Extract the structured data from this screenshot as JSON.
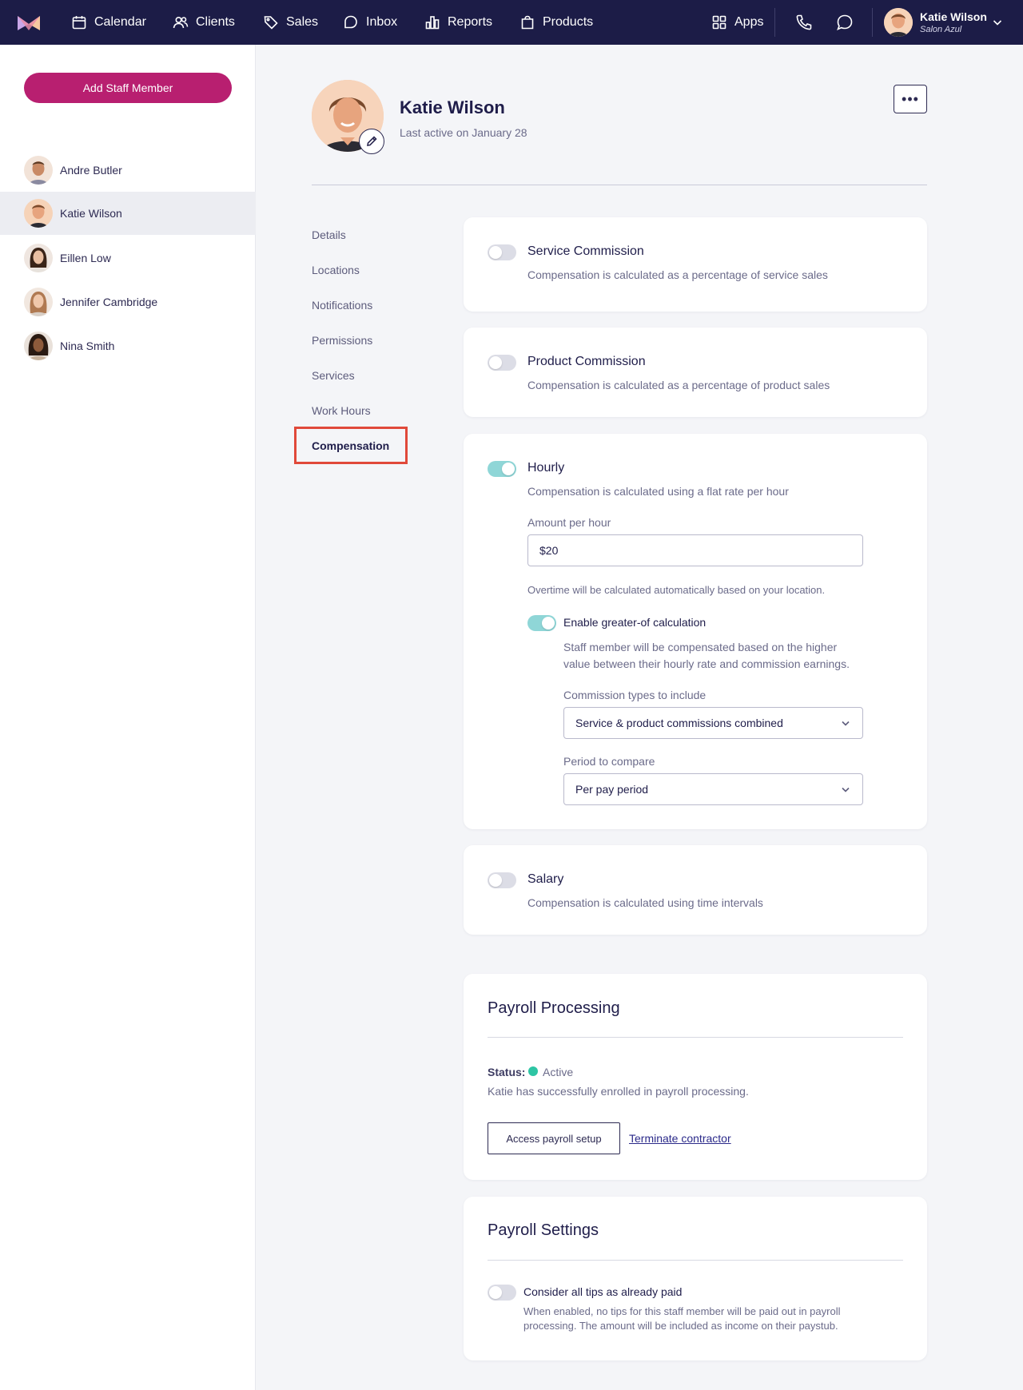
{
  "nav": {
    "items": [
      {
        "label": "Calendar",
        "icon": "calendar-icon"
      },
      {
        "label": "Clients",
        "icon": "clients-icon"
      },
      {
        "label": "Sales",
        "icon": "tag-icon"
      },
      {
        "label": "Inbox",
        "icon": "inbox-icon"
      },
      {
        "label": "Reports",
        "icon": "reports-icon"
      },
      {
        "label": "Products",
        "icon": "bag-icon"
      }
    ],
    "apps_label": "Apps",
    "user_name": "Katie Wilson",
    "user_location": "Salon Azul"
  },
  "sidebar": {
    "add_button": "Add Staff Member",
    "staff": [
      {
        "name": "Andre Butler"
      },
      {
        "name": "Katie Wilson"
      },
      {
        "name": "Eillen Low"
      },
      {
        "name": "Jennifer Cambridge"
      },
      {
        "name": "Nina Smith"
      }
    ]
  },
  "profile": {
    "name": "Katie Wilson",
    "last_active": "Last active on January 28"
  },
  "subnav": {
    "items": [
      "Details",
      "Locations",
      "Notifications",
      "Permissions",
      "Services",
      "Work Hours"
    ],
    "active": "Compensation"
  },
  "compensation": {
    "service": {
      "title": "Service Commission",
      "desc": "Compensation is calculated as a percentage of service sales",
      "enabled": false
    },
    "product": {
      "title": "Product Commission",
      "desc": "Compensation is calculated as a percentage of product sales",
      "enabled": false
    },
    "hourly": {
      "title": "Hourly",
      "desc": "Compensation is calculated using a flat rate per hour",
      "enabled": true,
      "amount_label": "Amount per hour",
      "amount_value": "$20",
      "overtime_note": "Overtime will be calculated automatically based on your location.",
      "greater_of": {
        "label": "Enable greater-of calculation",
        "enabled": true,
        "desc_line1": "Staff member will be compensated based on the higher",
        "desc_line2": "value between their hourly rate and commission earnings.",
        "commission_label": "Commission types to include",
        "commission_value": "Service & product commissions combined",
        "period_label": "Period to compare",
        "period_value": "Per pay period"
      }
    },
    "salary": {
      "title": "Salary",
      "desc": "Compensation is calculated using time intervals",
      "enabled": false
    }
  },
  "payroll_processing": {
    "title": "Payroll Processing",
    "status_label": "Status:",
    "status_value": "Active",
    "status_color": "#2ec5a4",
    "message": "Katie has successfully enrolled in payroll processing.",
    "access_button": "Access payroll setup",
    "terminate_link": "Terminate contractor"
  },
  "payroll_settings": {
    "title": "Payroll Settings",
    "tips_label": "Consider all tips as already paid",
    "tips_desc_line1": "When enabled, no tips for this staff member will be paid out in payroll",
    "tips_desc_line2": "processing. The amount will be included as income on their paystub.",
    "tips_enabled": false
  },
  "colors": {
    "nav_bg": "#1c1c47",
    "accent": "#b81f70",
    "toggle_on": "#8fd6d7",
    "highlight_box": "#e0493a"
  }
}
